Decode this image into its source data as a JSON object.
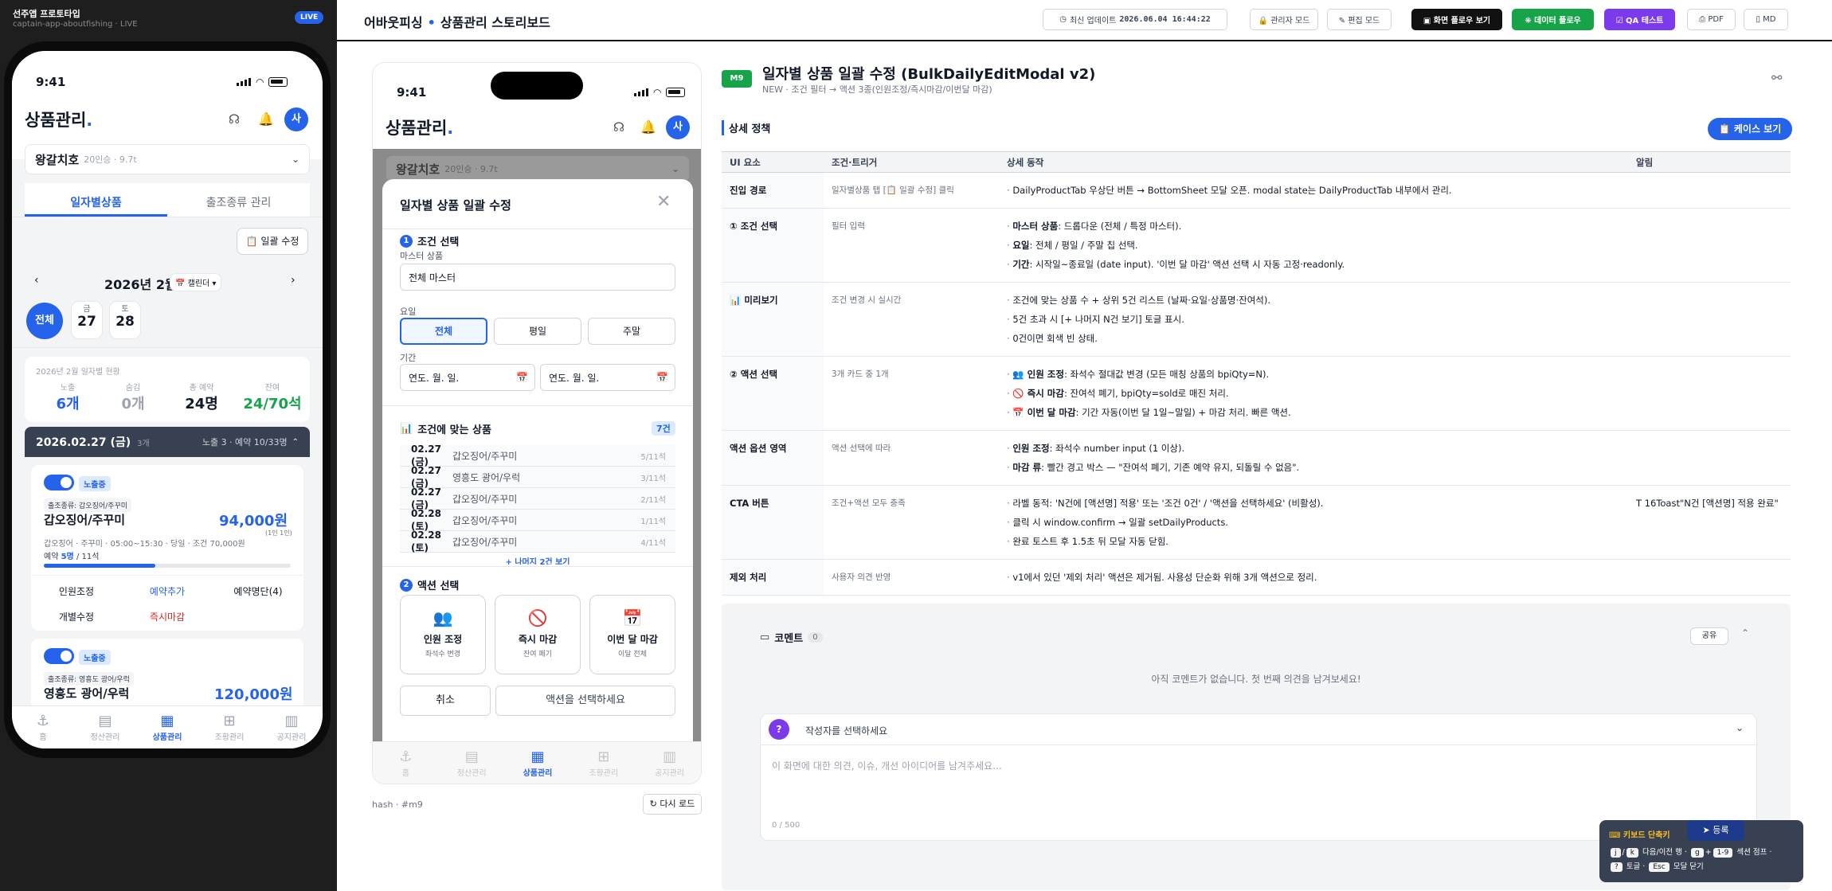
{
  "left": {
    "title": "선주앱 프로토타입",
    "subtitle": "captain-app-aboutfishing · LIVE",
    "live": "LIVE"
  },
  "phone": {
    "time": "9:41",
    "app_title": "상품관리",
    "app_title_dot": ".",
    "avatar": "사",
    "selector_name": "왕갈치호",
    "selector_meta": "20인승 · 9.7t",
    "tabs": [
      "일자별상품",
      "출조종류 관리"
    ],
    "bulk_btn": "📋 일괄 수정",
    "month": "2026년 2월",
    "calendar_btn": "📅 캘린더 ▾",
    "days": [
      {
        "top": "",
        "num": "전체"
      },
      {
        "top": "금",
        "num": "27"
      },
      {
        "top": "토",
        "num": "28"
      }
    ],
    "stats_caption": "2026년 2월 일자별 현황",
    "stats": [
      {
        "k": "노출",
        "v": "6개",
        "color": "#2563eb"
      },
      {
        "k": "숨김",
        "v": "0개",
        "color": "#9ca3af"
      },
      {
        "k": "총 예약",
        "v": "24명",
        "color": "#111827"
      },
      {
        "k": "잔여",
        "v": "24/70석",
        "color": "#16a34a"
      }
    ],
    "daybar": {
      "date": "2026.02.27 (금)",
      "count": "3개",
      "right": "노출 3 · 예약 10/33명"
    },
    "cards": [
      {
        "tag": "노출중",
        "type": "출조종류: 갑오징어/주꾸미",
        "name": "갑오징어/주꾸미",
        "price": "94,000원",
        "price_sub": "(1인 1인)",
        "meta": "갑오징어 · 주꾸미 · 05:00~15:30 · 당일 · 조건 70,000원",
        "resv_prefix": "예약 ",
        "resv_num": "5명",
        "resv_suffix": " / 11석",
        "progress": 0.45,
        "actions": [
          "인원조정",
          "예약추가",
          "예약명단(4)"
        ],
        "actions2": [
          "개별수정",
          "즉시마감"
        ]
      },
      {
        "tag": "노출중",
        "type": "출조종류: 영흥도 광어/우럭",
        "name": "영흥도 광어/우럭",
        "price": "120,000원"
      }
    ],
    "nav": [
      {
        "icon": "⚓",
        "label": "홈"
      },
      {
        "icon": "▤",
        "label": "정산관리"
      },
      {
        "icon": "▦",
        "label": "상품관리"
      },
      {
        "icon": "⊞",
        "label": "조황관리"
      },
      {
        "icon": "▥",
        "label": "공지관리"
      }
    ]
  },
  "topbar": {
    "brand": "어바웃피싱",
    "sep": "•",
    "page": "상품관리 스토리보드",
    "updated_label": "최신 업데이트",
    "updated_value": "2026.06.04 16:44:22",
    "buttons": [
      "🔒 관리자 모드",
      "✎ 편집 모드",
      "▣ 화면 플로우 보기",
      "❋ 데이터 플로우",
      "☑ QA 테스트",
      "⎙ PDF",
      "▯ MD"
    ]
  },
  "modal": {
    "title": "일자별 상품 일괄 수정",
    "s1": "조건 선택",
    "master_label": "마스터 상품",
    "master_value": "전체 마스터",
    "dow_label": "요일",
    "dows": [
      "전체",
      "평일",
      "주말"
    ],
    "period_label": "기간",
    "date_ph1": "연도. 월. 일.",
    "date_ph2": "연도. 월. 일.",
    "match_title": "조건에 맞는 상품",
    "match_count": "7건",
    "rows": [
      {
        "d": "02.27 (금)",
        "n": "갑오징어/주꾸미",
        "c": "5/11석"
      },
      {
        "d": "02.27 (금)",
        "n": "영흥도 광어/우럭",
        "c": "3/11석"
      },
      {
        "d": "02.27 (금)",
        "n": "갑오징어/주꾸미",
        "c": "2/11석"
      },
      {
        "d": "02.28 (토)",
        "n": "갑오징어/주꾸미",
        "c": "1/11석"
      },
      {
        "d": "02.28 (토)",
        "n": "갑오징어/주꾸미",
        "c": "4/11석"
      }
    ],
    "more": "+ 나머지 2건 보기",
    "s2": "액션 선택",
    "actions": [
      {
        "icon": "👥",
        "t": "인원 조정",
        "s": "좌석수 변경"
      },
      {
        "icon": "🚫",
        "t": "즉시 마감",
        "s": "잔여 폐기"
      },
      {
        "icon": "📅",
        "t": "이번 달 마감",
        "s": "이달 전체"
      }
    ],
    "cancel": "취소",
    "submit": "액션을 선택하세요"
  },
  "mid_footer": {
    "hash": "hash · #m9",
    "reload": "↻ 다시 로드"
  },
  "content": {
    "badge": "M9",
    "title": "일자별 상품 일괄 수정 (BulkDailyEditModal v2)",
    "subtitle": "NEW · 조건 필터 → 액션 3종(인원조정/즉시마감/이번달 마감)",
    "detail_heading": "상세 정책",
    "case_btn": "📋 케이스 보기",
    "headers": [
      "UI 요소",
      "조건·트리거",
      "상세 동작",
      "알림"
    ],
    "rows": [
      {
        "el": "진입 경로",
        "cond": "일자별상품 탭 [📋 일괄 수정] 클릭",
        "acts": [
          {
            "b": "",
            "t": "DailyProductTab 우상단 버튼 → BottomSheet 모달 오픈. modal state는 DailyProductTab 내부에서 관리."
          }
        ],
        "alert": ""
      },
      {
        "el": "① 조건 선택",
        "cond": "필터 입력",
        "acts": [
          {
            "b": "마스터 상품",
            "t": ": 드롭다운 (전체 / 특정 마스터)."
          },
          {
            "b": "요일",
            "t": ": 전체 / 평일 / 주말 칩 선택."
          },
          {
            "b": "기간",
            "t": ": 시작일~종료일 (date input). '이번 달 마감' 액션 선택 시 자동 고정·readonly."
          }
        ],
        "alert": ""
      },
      {
        "el": "📊 미리보기",
        "cond": "조건 변경 시 실시간",
        "acts": [
          {
            "b": "",
            "t": "조건에 맞는 상품 수 + 상위 5건 리스트 (날짜·요일·상품명·잔여석)."
          },
          {
            "b": "",
            "t": "5건 초과 시 [+ 나머지 N건 보기] 토글 표시."
          },
          {
            "b": "",
            "t": "0건이면 회색 빈 상태."
          }
        ],
        "alert": ""
      },
      {
        "el": "② 액션 선택",
        "cond": "3개 카드 중 1개",
        "acts": [
          {
            "b": "👥 인원 조정",
            "t": ": 좌석수 절대값 변경 (모든 매칭 상품의 bpiQty=N)."
          },
          {
            "b": "🚫 즉시 마감",
            "t": ": 잔여석 폐기, bpiQty=sold로 매진 처리."
          },
          {
            "b": "📅 이번 달 마감",
            "t": ": 기간 자동(이번 달 1일~말일) + 마감 처리. 빠른 액션."
          }
        ],
        "alert": ""
      },
      {
        "el": "액션 옵션 영역",
        "cond": "액션 선택에 따라",
        "acts": [
          {
            "b": "인원 조정",
            "t": ": 좌석수 number input (1 이상)."
          },
          {
            "b": "마감 류",
            "t": ": 빨간 경고 박스 — \"잔여석 폐기, 기존 예약 유지, 되돌릴 수 없음\"."
          }
        ],
        "alert": ""
      },
      {
        "el": "CTA 버튼",
        "cond": "조건+액션 모두 충족",
        "acts": [
          {
            "b": "",
            "t": "라벨 동적: 'N건에 [액션명] 적용' 또는 '조건 0건' / '액션을 선택하세요' (비활성)."
          },
          {
            "b": "",
            "t": "클릭 시 window.confirm → 일괄 setDailyProducts."
          },
          {
            "b": "",
            "t": "완료 토스트 후 1.5초 뒤 모달 자동 닫힘."
          }
        ],
        "alert": "T 16Toast\"N건 [액션명] 적용 완료\""
      },
      {
        "el": "제외 처리",
        "cond": "사용자 의견 반영",
        "acts": [
          {
            "b": "",
            "t": "v1에서 있던 '제외 처리' 액션은 제거됨. 사용성 단순화 위해 3개 액션으로 정리."
          }
        ],
        "alert": ""
      }
    ],
    "comments": {
      "title": "코멘트",
      "count": "0",
      "share": "공유",
      "empty": "아직 코멘트가 없습니다. 첫 번째 의견을 남겨보세요!",
      "author_ph": "작성자를 선택하세요",
      "author_avatar": "?",
      "text_ph": "이 화면에 대한 의견, 이슈, 개선 아이디어를 남겨주세요...",
      "counter": "0 / 500",
      "submit": "등록"
    },
    "shortcuts": {
      "title": "⌨ 키보드 단축키",
      "k1": "j",
      "k2": "k",
      "t1": "다음/이전 행 ·",
      "k3": "g",
      "k4": "1-9",
      "t2": "섹션 점프 ·",
      "k5": "?",
      "t3": "토글 ·",
      "k6": "Esc",
      "t4": "모달 닫기"
    }
  }
}
